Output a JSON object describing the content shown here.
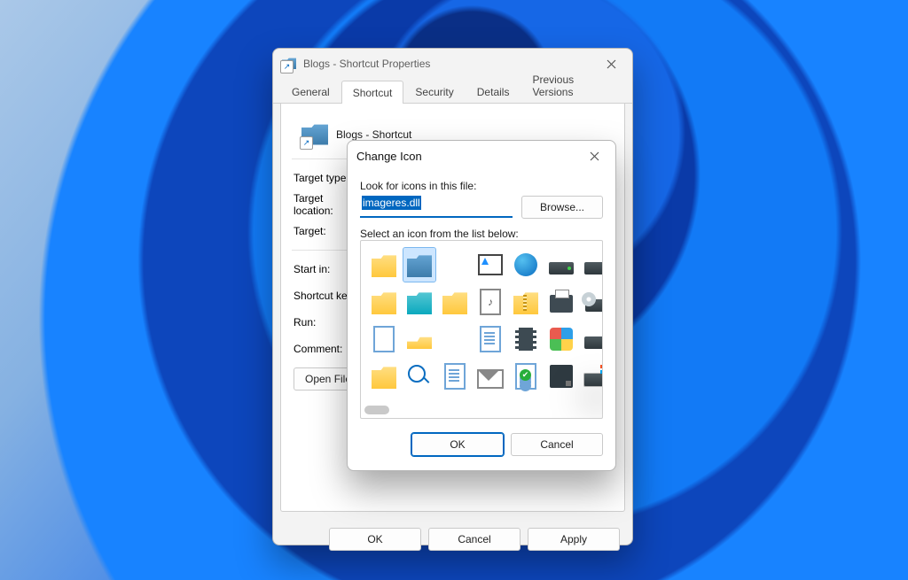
{
  "properties_window": {
    "title": "Blogs - Shortcut Properties",
    "close_tooltip": "Close",
    "tabs": [
      "General",
      "Shortcut",
      "Security",
      "Details",
      "Previous Versions"
    ],
    "active_tab": "Shortcut",
    "shortcut_name": "Blogs - Shortcut",
    "fields": {
      "target_type": "Target type:",
      "target_location": "Target location:",
      "target": "Target:",
      "start_in": "Start in:",
      "shortcut_key": "Shortcut key:",
      "run": "Run:",
      "comment": "Comment:"
    },
    "panel_buttons": {
      "open_location": "Open File Location"
    },
    "buttons": {
      "ok": "OK",
      "cancel": "Cancel",
      "apply": "Apply"
    }
  },
  "change_icon_dialog": {
    "title": "Change Icon",
    "close_tooltip": "Close",
    "look_label": "Look for icons in this file:",
    "path_value": "imageres.dll",
    "browse": "Browse...",
    "select_label": "Select an icon from the list below:",
    "selected_index": 1,
    "grid": [
      "folder-yellow",
      "folder-blue",
      "blank",
      "picture",
      "globe",
      "drive",
      "drive",
      "folder-yellow",
      "folder-cyan",
      "folder-yellow",
      "music-doc",
      "zip-folder",
      "printer",
      "cd-drive",
      "doc-blank",
      "folder-small-yellow",
      "blank",
      "doc",
      "film",
      "control-panel",
      "x-drive",
      "folder-yellow",
      "magnifier",
      "doc",
      "mail",
      "doc-check",
      "diskette",
      "drive-win"
    ],
    "buttons": {
      "ok": "OK",
      "cancel": "Cancel"
    }
  }
}
